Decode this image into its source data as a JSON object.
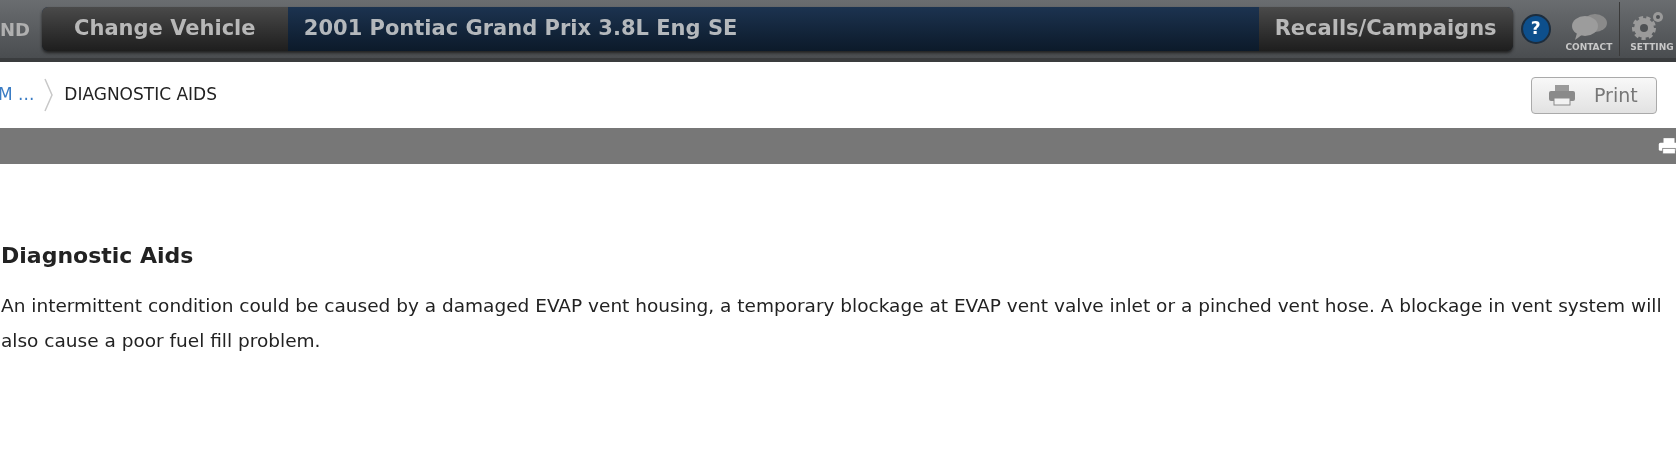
{
  "header": {
    "brand_fragment": "ND",
    "change_vehicle": "Change Vehicle",
    "vehicle": "2001 Pontiac Grand Prix 3.8L Eng SE",
    "recalls": "Recalls/Campaigns",
    "help": "?",
    "contact": "CONTACT",
    "settings": "SETTING"
  },
  "breadcrumb": [
    {
      "label": "M ...",
      "kind": "link"
    },
    {
      "label": "DIAGNOSTIC AIDS",
      "kind": "current"
    }
  ],
  "print_button": "Print",
  "content": {
    "heading": "Diagnostic Aids",
    "paragraph": "An intermittent condition could be caused by a damaged EVAP vent housing, a temporary blockage at EVAP vent valve inlet or a pinched vent hose. A blockage in vent system will also cause a poor fuel fill problem."
  }
}
